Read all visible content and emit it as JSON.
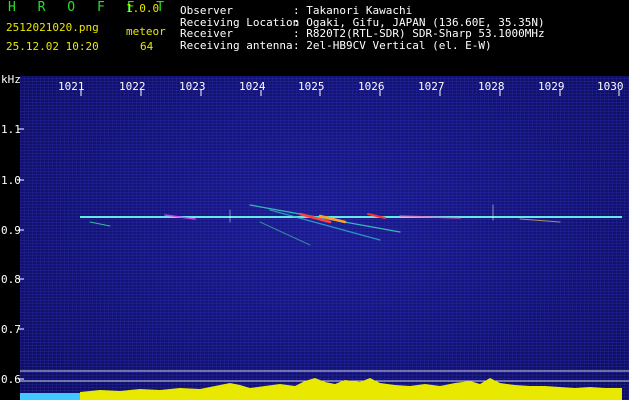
{
  "header": {
    "app_name": "H R O F F T",
    "version": "1.0.0",
    "filename": "2512021020.png",
    "datetime": "25.12.02 10:20",
    "meteor_label": "meteor",
    "meteor_count": "64"
  },
  "info": {
    "observer": {
      "label": "Observer",
      "value": ": Takanori Kawachi"
    },
    "location": {
      "label": "Receiving Location",
      "value": ": Ogaki, Gifu, JAPAN (136.60E, 35.35N)"
    },
    "receiver": {
      "label": "Receiver",
      "value": ": R820T2(RTL-SDR) SDR-Sharp 53.1000MHz"
    },
    "antenna": {
      "label": "Receiving antenna",
      "value": ": 2el-HB9CV Vertical (el. E-W)"
    }
  },
  "axes": {
    "y_unit": "kHz",
    "x_ticks": [
      "1021",
      "1022",
      "1023",
      "1024",
      "1025",
      "1026",
      "1027",
      "1028",
      "1029",
      "1030"
    ],
    "y_ticks": [
      "1.1",
      "1.0",
      "0.9",
      "0.8",
      "0.7",
      "0.6"
    ]
  },
  "colors": {
    "background": "#000000",
    "spectrum": "#141472",
    "trace_main": "#40e0ff",
    "activity": "#e8e800",
    "title": "#28e028"
  }
}
